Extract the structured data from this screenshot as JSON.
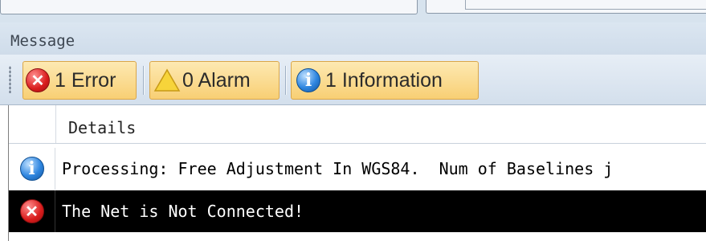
{
  "message_panel": {
    "title": "Message"
  },
  "toolbar": {
    "error_label": "1 Error",
    "alarm_label": "0 Alarm",
    "info_label": "1 Information"
  },
  "grid": {
    "columns": [
      "Details"
    ],
    "rows": [
      {
        "type": "info-icon",
        "text": "Processing: Free Adjustment In WGS84.  Num of Baselines j"
      },
      {
        "type": "error-icon",
        "text": "The Net is Not Connected!"
      }
    ]
  },
  "colors": {
    "button_bg": "#f8cf74",
    "button_border": "#d9a64a",
    "selected_row_bg": "#000000",
    "panel_bg": "#d7e3ee"
  }
}
